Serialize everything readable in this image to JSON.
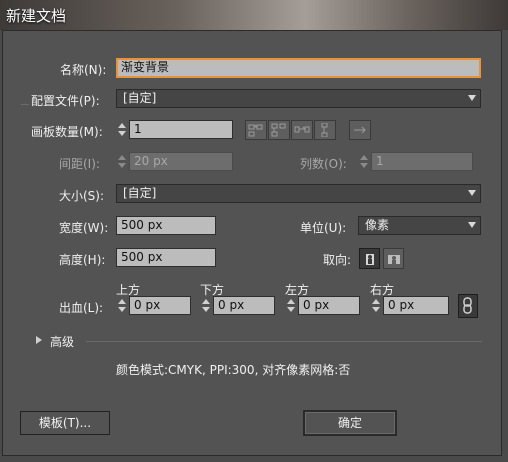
{
  "window": {
    "title": "新建文档"
  },
  "form": {
    "name_label": "名称(N):",
    "name_value": "渐变背景",
    "profile_label": "配置文件(P):",
    "profile_value": "[自定]",
    "artboards_label": "画板数量(M):",
    "artboards_value": "1",
    "spacing_label": "间距(I):",
    "spacing_value": "20 px",
    "columns_label": "列数(O):",
    "columns_value": "1",
    "size_label": "大小(S):",
    "size_value": "[自定]",
    "width_label": "宽度(W):",
    "width_value": "500 px",
    "units_label": "单位(U):",
    "units_value": "像素",
    "height_label": "高度(H):",
    "height_value": "500 px",
    "orientation_label": "取向:",
    "bleed_label": "出血(L):",
    "bleed": {
      "top_label": "上方",
      "top_value": "0 px",
      "bottom_label": "下方",
      "bottom_value": "0 px",
      "left_label": "左方",
      "left_value": "0 px",
      "right_label": "右方",
      "right_value": "0 px"
    },
    "advanced_label": "高级",
    "info_text": "颜色模式:CMYK, PPI:300, 对齐像素网格:否"
  },
  "buttons": {
    "template_label": "模板(T)...",
    "ok_label": "确定"
  },
  "colors": {
    "focus_border": "#e8923a",
    "dialog_bg": "#535353"
  },
  "icons": {
    "artboard_layout": [
      "grid-by-row-icon",
      "grid-by-column-icon",
      "arrange-by-row-icon",
      "arrange-by-column-icon"
    ],
    "layout_direction": "right-arrow-icon",
    "orientation": [
      "portrait-icon",
      "landscape-icon"
    ],
    "bleed_link": "chain-link-icon",
    "advanced_toggle": "disclosure-triangle-icon"
  }
}
